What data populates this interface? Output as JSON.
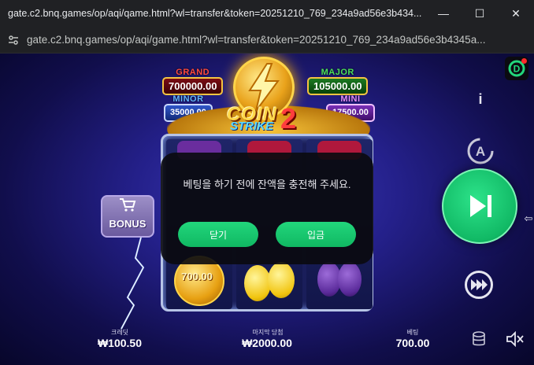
{
  "window": {
    "title": "gate.c2.bnq.games/op/aqi/qame.html?wl=transfer&token=20251210_769_234a9ad56e3b434...",
    "controls": {
      "minimize": "—",
      "maximize": "☐",
      "close": "✕"
    }
  },
  "address_bar": {
    "url": "gate.c2.bnq.games/op/aqi/game.html?wl=transfer&token=20251210_769_234a9ad56e3b4345a..."
  },
  "game": {
    "jackpots": {
      "grand": {
        "label": "GRAND",
        "value": "700000.00"
      },
      "minor": {
        "label": "MINOR",
        "value": "35000.00"
      },
      "major": {
        "label": "MAJOR",
        "value": "105000.00"
      },
      "mini": {
        "label": "MINI",
        "value": "17500.00"
      }
    },
    "logo": {
      "word1": "COIN",
      "word2": "STRIKE",
      "number": "2"
    },
    "coin_symbol_value": "700.00",
    "bonus_button_label": "BONUS",
    "dialog": {
      "message": "베팅을 하기 전에 잔액을 충전해 주세요.",
      "close_label": "닫기",
      "deposit_label": "입금"
    },
    "stats": {
      "balance_label": "크레딧",
      "balance_value": "₩100.50",
      "win_label": "마지막 당첨",
      "win_value": "₩2000.00",
      "bet_label": "베팅",
      "bet_value": "700.00"
    },
    "colors": {
      "accent_green": "#16c46f",
      "jackpot_gold": "#f4c542"
    },
    "icons": [
      "d-logo-icon",
      "info-icon",
      "autoplay-icon",
      "play-icon",
      "fast-forward-icon",
      "coins-icon",
      "mute-icon",
      "expand-arrow-icon"
    ]
  }
}
